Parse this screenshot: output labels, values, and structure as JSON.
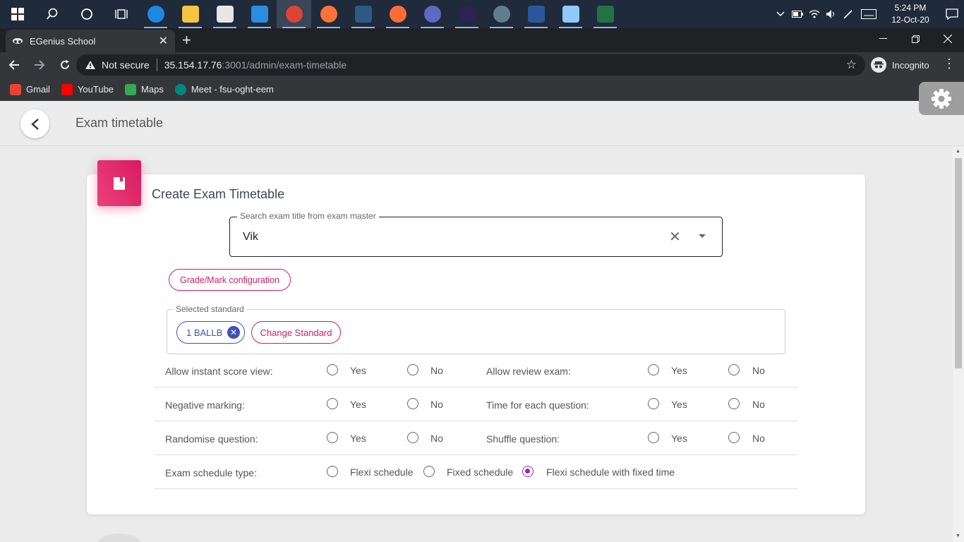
{
  "taskbar": {
    "apps": [
      {
        "name": "edge",
        "color": "#1e88e5"
      },
      {
        "name": "file-explorer",
        "color": "#f4c542"
      },
      {
        "name": "store",
        "color": "#e6e6e6"
      },
      {
        "name": "mail",
        "color": "#2a8de0"
      },
      {
        "name": "chrome",
        "color": "#db4437"
      },
      {
        "name": "firefox",
        "color": "#ff7139"
      },
      {
        "name": "mysql-workbench",
        "color": "#2b5b84"
      },
      {
        "name": "postman",
        "color": "#ff6c37"
      },
      {
        "name": "app-a",
        "color": "#5c6bc0"
      },
      {
        "name": "eclipse",
        "color": "#2c2255"
      },
      {
        "name": "app-b",
        "color": "#607d8b"
      },
      {
        "name": "word",
        "color": "#2b579a"
      },
      {
        "name": "app-c",
        "color": "#90caf9"
      },
      {
        "name": "excel",
        "color": "#217346"
      }
    ],
    "time": "5:24 PM",
    "date": "12-Oct-20"
  },
  "browser": {
    "tab_title": "EGenius School",
    "security": "Not secure",
    "url_host": "35.154.17.76",
    "url_rest": ":3001/admin/exam-timetable",
    "incognito": "Incognito",
    "bookmarks": [
      {
        "label": "Gmail",
        "icon": "gmail-icon",
        "color": "#ea4335"
      },
      {
        "label": "YouTube",
        "icon": "youtube-icon",
        "color": "#ff0000"
      },
      {
        "label": "Maps",
        "icon": "maps-icon",
        "color": "#34a853"
      },
      {
        "label": "Meet - fsu-oght-eem",
        "icon": "meet-icon",
        "color": "#00897b"
      }
    ]
  },
  "page": {
    "title": "Exam timetable",
    "card_title": "Create Exam Timetable",
    "search": {
      "label": "Search exam title from exam master",
      "value": "Vik"
    },
    "grade_button": "Grade/Mark configuration",
    "standard": {
      "label": "Selected standard",
      "chip": "1 BALLB",
      "change_button": "Change Standard"
    },
    "options": {
      "yes": "Yes",
      "no": "No",
      "rows": [
        {
          "left": "Allow instant score view:",
          "right": "Allow review exam:"
        },
        {
          "left": "Negative marking:",
          "right": "Time for each question:"
        },
        {
          "left": "Randomise question:",
          "right": "Shuffle question:"
        }
      ],
      "schedule": {
        "label": "Exam schedule type:",
        "choices": [
          "Flexi schedule",
          "Fixed schedule",
          "Flexi schedule with fixed time"
        ],
        "selected": "Flexi schedule with fixed time"
      }
    }
  },
  "colors": {
    "accent": "#d81b60",
    "chip": "#3f51b5",
    "radio_selected": "#9c27b0"
  }
}
